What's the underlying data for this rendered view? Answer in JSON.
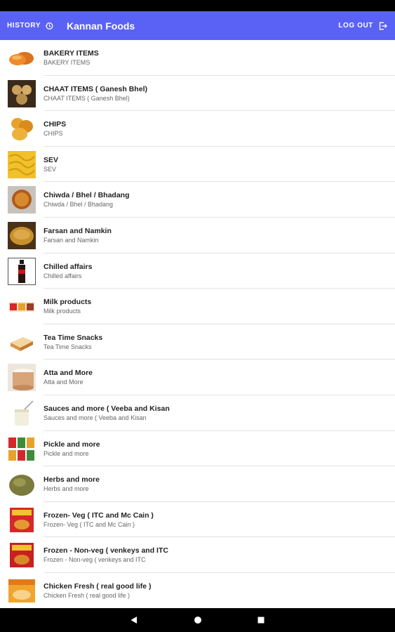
{
  "app": {
    "title": "Kannan Foods",
    "history_label": "HISTORY",
    "logout_label": "LOG OUT",
    "accent_color": "#5a62f5"
  },
  "categories": [
    {
      "name": "BAKERY ITEMS",
      "subtitle": "BAKERY ITEMS",
      "icon": "bakery-image"
    },
    {
      "name": "CHAAT ITEMS ( Ganesh Bhel)",
      "subtitle": "CHAAT ITEMS ( Ganesh Bhel)",
      "icon": "chaat-image"
    },
    {
      "name": "CHIPS",
      "subtitle": "CHIPS",
      "icon": "chips-image"
    },
    {
      "name": "SEV",
      "subtitle": "SEV",
      "icon": "sev-image"
    },
    {
      "name": "Chiwda / Bhel / Bhadang",
      "subtitle": "Chiwda / Bhel / Bhadang",
      "icon": "chiwda-image"
    },
    {
      "name": "Farsan and Namkin",
      "subtitle": "Farsan and Namkin",
      "icon": "farsan-image"
    },
    {
      "name": "Chilled affairs",
      "subtitle": "Chilled affairs",
      "icon": "cola-bottle-image"
    },
    {
      "name": "Milk products",
      "subtitle": "Milk products",
      "icon": "milk-products-image"
    },
    {
      "name": "Tea Time Snacks",
      "subtitle": "Tea Time Snacks",
      "icon": "tea-snacks-image"
    },
    {
      "name": "Atta and More",
      "subtitle": "Atta and More",
      "icon": "atta-image"
    },
    {
      "name": "Sauces and more ( Veeba and Kisan",
      "subtitle": "Sauces and more ( Veeba and Kisan",
      "icon": "sauce-image"
    },
    {
      "name": "Pickle and more",
      "subtitle": "Pickle and more",
      "icon": "pickle-jars-image"
    },
    {
      "name": "Herbs and more",
      "subtitle": "Herbs and more",
      "icon": "herbs-image"
    },
    {
      "name": "Frozen- Veg ( ITC and Mc Cain )",
      "subtitle": "Frozen- Veg ( ITC and Mc Cain )",
      "icon": "frozen-veg-image"
    },
    {
      "name": "Frozen - Non-veg ( venkeys and ITC",
      "subtitle": "Frozen - Non-veg ( venkeys and ITC",
      "icon": "frozen-nonveg-image"
    },
    {
      "name": "Chicken Fresh ( real good life )",
      "subtitle": "Chicken Fresh ( real good life )",
      "icon": "chicken-fresh-image"
    }
  ],
  "navbar": {
    "back_icon": "back-triangle-icon",
    "home_icon": "home-circle-icon",
    "recents_icon": "recents-square-icon"
  }
}
